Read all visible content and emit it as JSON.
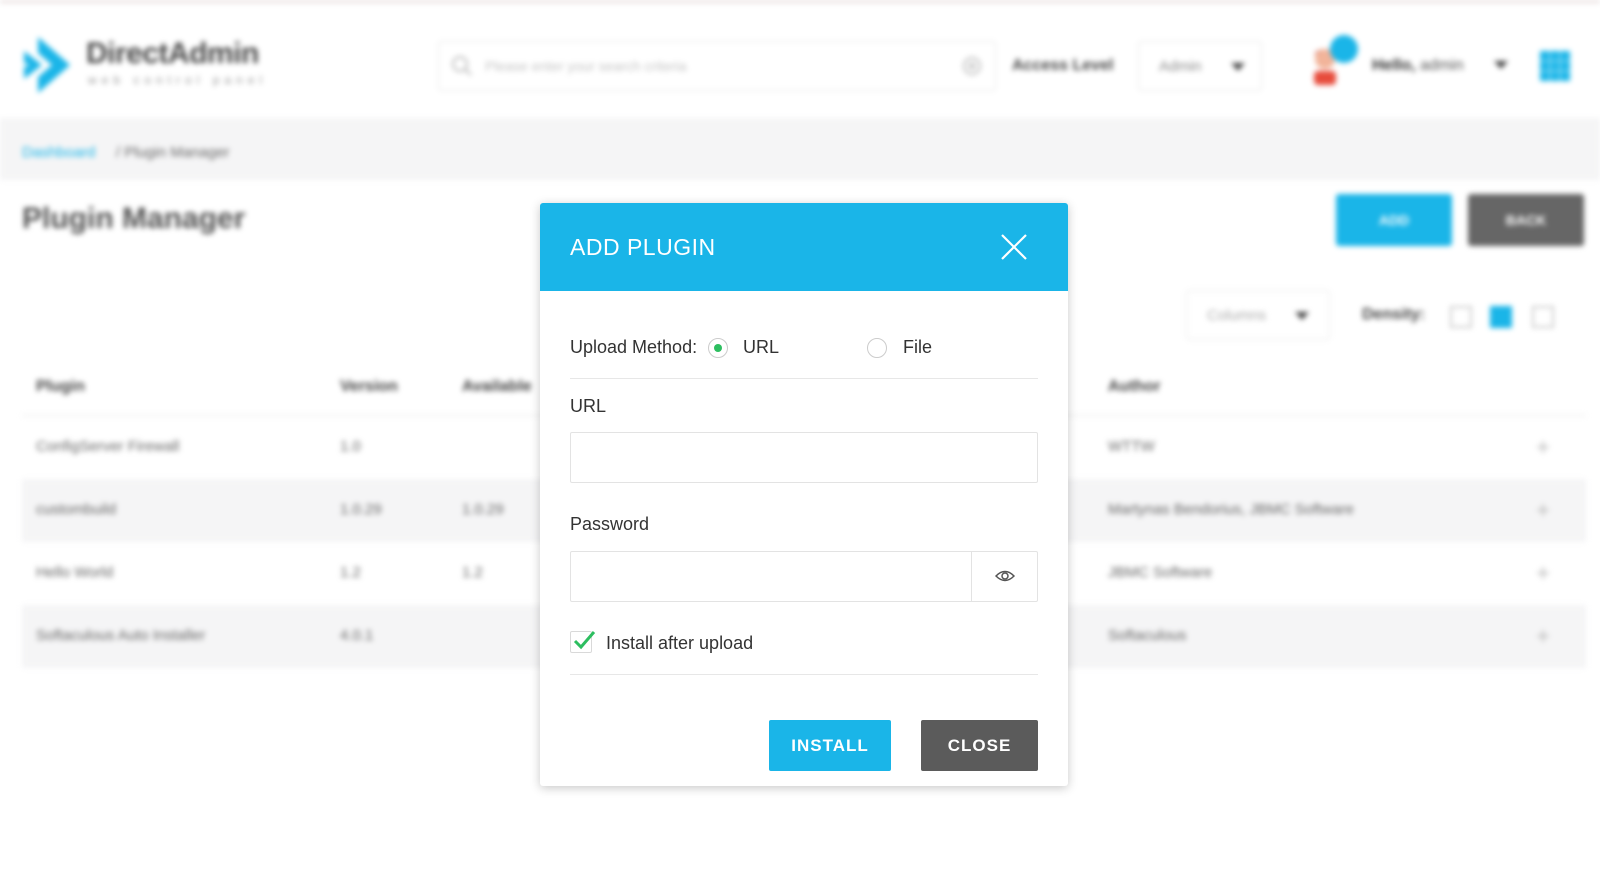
{
  "header": {
    "logo_text": "DirectAdmin",
    "logo_sub": "web control panel",
    "search_placeholder": "Please enter your search criteria",
    "access_level_label": "Access Level",
    "access_level_value": "Admin",
    "greeting": "Hello,",
    "username": "admin",
    "icons": [
      "directadmin-logo",
      "search-icon",
      "gear-icon",
      "caret-down-icon",
      "avatar",
      "notification-dot",
      "grid-menu-icon"
    ]
  },
  "breadcrumb": {
    "home": "Dashboard",
    "separator": "/",
    "current": "Plugin Manager"
  },
  "page": {
    "title": "Plugin Manager",
    "add_label": "ADD",
    "back_label": "BACK",
    "columns_label": "Columns",
    "density_label": "Density:"
  },
  "table": {
    "headers": [
      "Plugin",
      "Version",
      "Available",
      "Author"
    ],
    "rows": [
      {
        "plugin": "ConfigServer Firewall",
        "version": "1.0",
        "available": "",
        "author": "WTTW"
      },
      {
        "plugin": "custombuild",
        "version": "1.0.29",
        "available": "1.0.29",
        "author": "Martynas Bendorius, JBMC Software"
      },
      {
        "plugin": "Hello World",
        "version": "1.2",
        "available": "1.2",
        "author": "JBMC Software"
      },
      {
        "plugin": "Softaculous Auto Installer",
        "version": "4.0.1",
        "available": "",
        "author": "Softaculous"
      }
    ],
    "row_action_icon": "plus-icon"
  },
  "modal": {
    "title": "ADD PLUGIN",
    "upload_method_label": "Upload Method:",
    "upload_options": [
      "URL",
      "File"
    ],
    "upload_selected": "URL",
    "url_label": "URL",
    "url_value": "",
    "password_label": "Password",
    "password_value": "",
    "install_after_upload_label": "Install after upload",
    "install_after_upload_checked": true,
    "install_button": "INSTALL",
    "close_button": "CLOSE"
  },
  "colors": {
    "accent": "#1ab5e8",
    "radio_on": "#2dbe60",
    "close_button": "#5b5b5b",
    "back_button": "#666666"
  }
}
